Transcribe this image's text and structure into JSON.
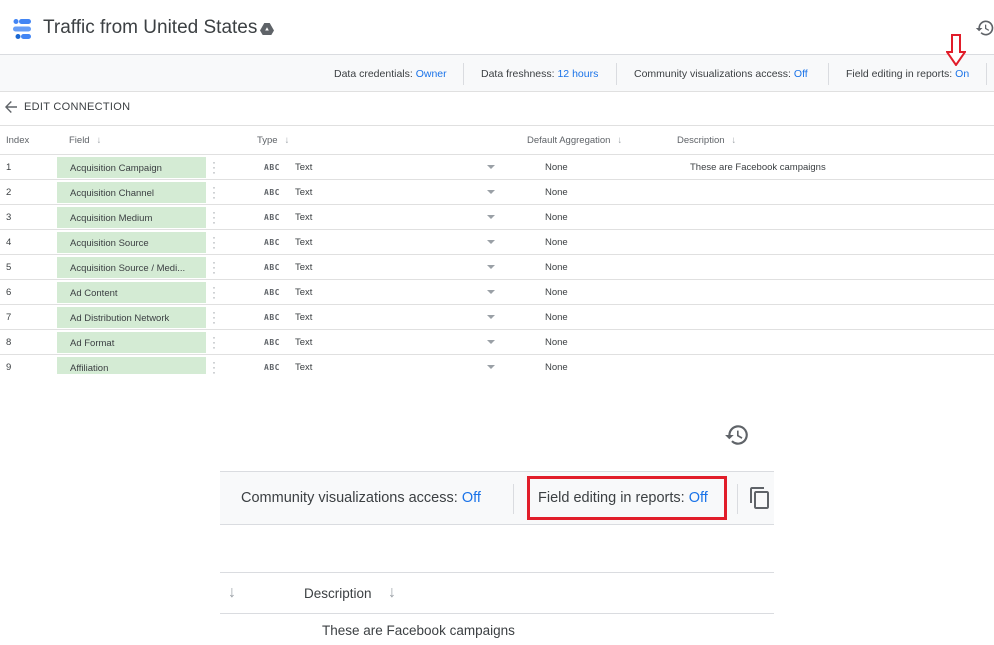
{
  "header": {
    "title": "Traffic from United States"
  },
  "info_strip": {
    "items": [
      {
        "label": "Data credentials:",
        "value": "Owner"
      },
      {
        "label": "Data freshness:",
        "value": "12 hours"
      },
      {
        "label": "Community visualizations access:",
        "value": "Off"
      },
      {
        "label": "Field editing in reports:",
        "value": "On"
      }
    ]
  },
  "edit_connection": {
    "label": "EDIT CONNECTION"
  },
  "table": {
    "headers": {
      "index": "Index",
      "field": "Field",
      "type": "Type",
      "aggregation": "Default Aggregation",
      "description": "Description"
    },
    "type_icon_text": "ABC",
    "rows": [
      {
        "index": "1",
        "field": "Acquisition Campaign",
        "type": "Text",
        "aggregation": "None",
        "description": "These are Facebook campaigns"
      },
      {
        "index": "2",
        "field": "Acquisition Channel",
        "type": "Text",
        "aggregation": "None",
        "description": ""
      },
      {
        "index": "3",
        "field": "Acquisition Medium",
        "type": "Text",
        "aggregation": "None",
        "description": ""
      },
      {
        "index": "4",
        "field": "Acquisition Source",
        "type": "Text",
        "aggregation": "None",
        "description": ""
      },
      {
        "index": "5",
        "field": "Acquisition Source / Medi...",
        "type": "Text",
        "aggregation": "None",
        "description": ""
      },
      {
        "index": "6",
        "field": "Ad Content",
        "type": "Text",
        "aggregation": "None",
        "description": ""
      },
      {
        "index": "7",
        "field": "Ad Distribution Network",
        "type": "Text",
        "aggregation": "None",
        "description": ""
      },
      {
        "index": "8",
        "field": "Ad Format",
        "type": "Text",
        "aggregation": "None",
        "description": ""
      },
      {
        "index": "9",
        "field": "Affiliation",
        "type": "Text",
        "aggregation": "None",
        "description": ""
      }
    ]
  },
  "zoom": {
    "community_label": "Community visualizations access:",
    "community_value": "Off",
    "field_editing_label": "Field editing in reports:",
    "field_editing_value": "Off",
    "description_header": "Description",
    "description_cell": "These are Facebook campaigns"
  },
  "colors": {
    "accent": "#1a73e8",
    "highlight_red": "#e11d2a",
    "field_chip": "#d4ebd4"
  },
  "icons": {
    "logo": "data-studio-logo-icon",
    "drive": "shared-drive-icon",
    "history": "history-icon",
    "back": "arrow-left-icon",
    "sort": "arrow-down-icon",
    "copy": "copy-icon",
    "kebab": "more-vert-icon",
    "dropdown": "dropdown-caret-icon"
  }
}
